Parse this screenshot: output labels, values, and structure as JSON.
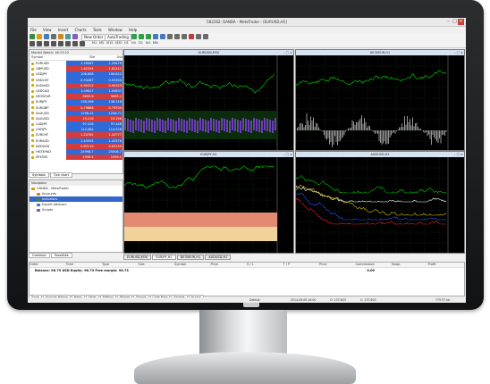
{
  "window": {
    "title": "582262: OANDA - MetaTrader - [EURUSD,H1]"
  },
  "menu": [
    "File",
    "View",
    "Insert",
    "Charts",
    "Tools",
    "Window",
    "Help"
  ],
  "toolbar": {
    "new_order": "New Order",
    "auto_trading": "AutoTrading",
    "timeframes": [
      "M1",
      "M5",
      "M15",
      "M30",
      "H1",
      "H4",
      "D1",
      "W1",
      "MN"
    ]
  },
  "market_watch": {
    "title": "Market Watch: 16:13:22",
    "columns": [
      "Symbol",
      "Bid",
      "Ask"
    ],
    "rows": [
      {
        "symbol": "EURUSD",
        "bid": "1.29467",
        "ask": "1.29479",
        "dir": "up"
      },
      {
        "symbol": "GBPUSD",
        "bid": "1.62394",
        "ask": "1.62411",
        "dir": "down"
      },
      {
        "symbol": "USDJPY",
        "bid": "106.808",
        "ask": "106.822",
        "dir": "up"
      },
      {
        "symbol": "USDCHF",
        "bid": "0.93287",
        "ask": "0.93300",
        "dir": "up"
      },
      {
        "symbol": "AUDUSD",
        "bid": "0.90312",
        "ask": "0.90329",
        "dir": "down"
      },
      {
        "symbol": "USDCAD",
        "bid": "1.09617",
        "ask": "1.09637",
        "dir": "up"
      },
      {
        "symbol": "DE30EUR",
        "bid": "9693.6",
        "ask": "9695.1",
        "dir": "down"
      },
      {
        "symbol": "EURJPY",
        "bid": "138.296",
        "ask": "138.318",
        "dir": "up"
      },
      {
        "symbol": "EURGBP",
        "bid": "0.79686",
        "ask": "0.79709",
        "dir": "down"
      },
      {
        "symbol": "XAUUSD",
        "bid": "1256.21",
        "ask": "1256.71",
        "dir": "up"
      },
      {
        "symbol": "XAGUSD",
        "bid": "19.216",
        "ask": "19.256",
        "dir": "down"
      },
      {
        "symbol": "CADJPY",
        "bid": "97.418",
        "ask": "97.448",
        "dir": "up"
      },
      {
        "symbol": "CHFJPY",
        "bid": "114.484",
        "ask": "114.528",
        "dir": "up"
      },
      {
        "symbol": "EURCHF",
        "bid": "1.20761",
        "ask": "1.20777",
        "dir": "down"
      },
      {
        "symbol": "EURAUD",
        "bid": "1.43335",
        "ask": "1.43376",
        "dir": "up"
      },
      {
        "symbol": "NZDUSD",
        "bid": "0.83119",
        "ask": "0.83145",
        "dir": "down"
      },
      {
        "symbol": "HK33HKD",
        "bid": "24998.7",
        "ask": "25006.7",
        "dir": "up"
      },
      {
        "symbol": "SPX500",
        "bid": "1998.4",
        "ask": "1999.1",
        "dir": "down"
      }
    ],
    "tabs": [
      "Symbols",
      "Tick chart"
    ]
  },
  "navigator": {
    "title": "Navigator",
    "items": [
      {
        "label": "OANDA - MetaTrader",
        "selected": false
      },
      {
        "label": "Accounts",
        "selected": false
      },
      {
        "label": "Indicators",
        "selected": true
      },
      {
        "label": "Expert Advisors",
        "selected": false
      },
      {
        "label": "Scripts",
        "selected": false
      }
    ],
    "tabs": [
      "Common",
      "Favorites"
    ]
  },
  "charts": [
    {
      "title": "EURUSD,M30",
      "color": "#00d400"
    },
    {
      "title": "DE30EUR,H1",
      "color": "#00d400"
    },
    {
      "title": "EURJPY,H1",
      "color": "#00d400"
    },
    {
      "title": "AUDUSD,H1",
      "color": "#00d400"
    }
  ],
  "chart_tabs": [
    "EURUSD,M30",
    "EURJPY,H1",
    "DE30EUR,H1",
    "AUDUSD,H1"
  ],
  "terminal": {
    "columns": [
      "Order",
      "Time",
      "Type",
      "Size",
      "Symbol",
      "Price",
      "S / L",
      "T / P",
      "Price",
      "Commission",
      "Swap",
      "Profit"
    ],
    "balance": "Balance: 96.73 USD  Equity: 96.73  Free margin: 96.73",
    "balance_profit": "0.00",
    "tabs": [
      "Trade",
      "Account History",
      "News",
      "Alerts",
      "Mailbox",
      "Market",
      "Signals",
      "Code Base",
      "Experts",
      "Journal"
    ]
  },
  "status": {
    "profile": "Default",
    "datetime": "2014.09.09 16:00",
    "open": "O: 137.603",
    "close": "C: 137.603",
    "bars": "7757/7 kb"
  }
}
